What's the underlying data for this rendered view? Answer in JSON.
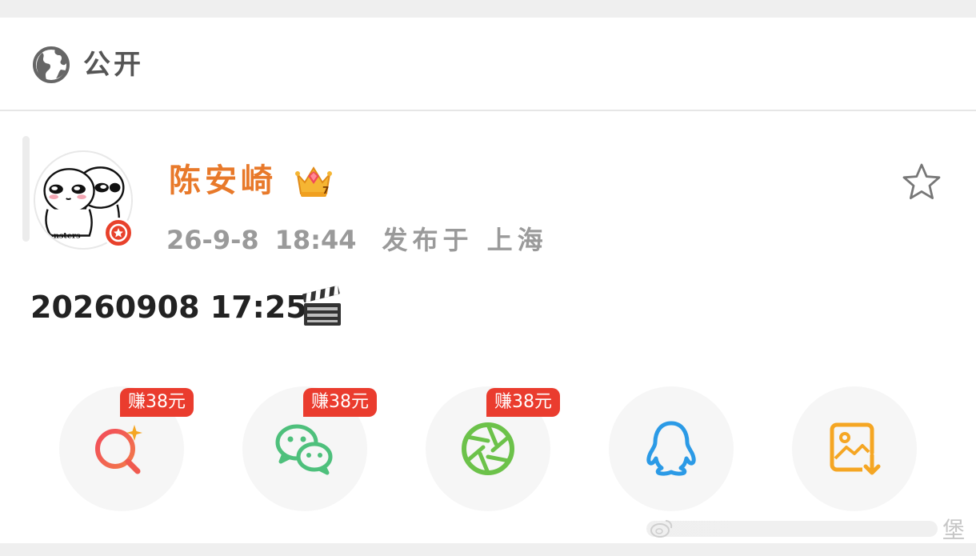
{
  "header": {
    "visibility_icon": "globe-icon",
    "visibility_label": "公开"
  },
  "post": {
    "author_name": "陈安崎",
    "author_badge_icon": "crown-icon",
    "avatar_caption": "Monsters",
    "date": "26-9-8",
    "time": "18:44",
    "location": "发布于 上海",
    "text": "20260908 17:25",
    "text_emoji_icon": "clapper-board-icon",
    "favorite_icon": "star-outline-icon"
  },
  "share": {
    "buttons": [
      {
        "icon": "search-sparkle-icon",
        "reward": "赚38元",
        "color": "#ef4f5c"
      },
      {
        "icon": "wechat-icon",
        "reward": "赚38元",
        "color": "#4ec07c"
      },
      {
        "icon": "moments-shutter-icon",
        "reward": "赚38元",
        "color": "#6cc24a"
      },
      {
        "icon": "qq-penguin-icon",
        "reward": "",
        "color": "#2b9ae6"
      },
      {
        "icon": "save-image-icon",
        "reward": "",
        "color": "#f5a623"
      }
    ]
  },
  "watermark": {
    "char": "堡"
  },
  "colors": {
    "username": "#e8792a",
    "reward_tag": "#ea3c2e",
    "meta_text": "#9a9a9a",
    "button_bg": "#f6f6f6"
  }
}
